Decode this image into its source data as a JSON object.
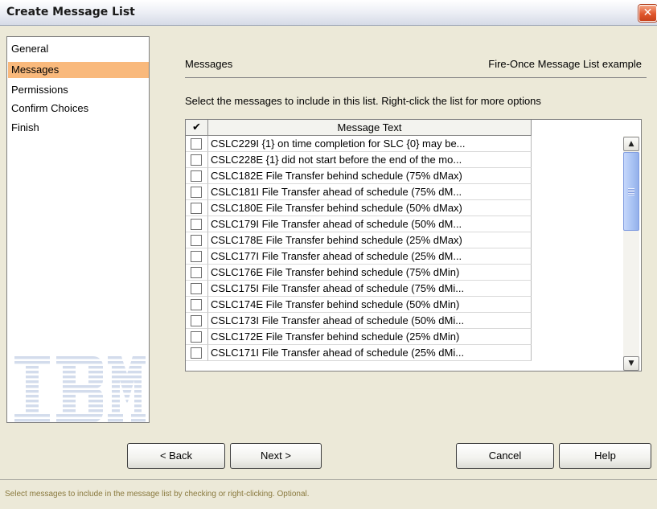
{
  "window": {
    "title": "Create Message List",
    "close_symbol": "✕"
  },
  "nav": {
    "items": [
      {
        "label": "General"
      },
      {
        "label": "Messages",
        "selected": true
      },
      {
        "label": "Permissions"
      },
      {
        "label": "Confirm Choices"
      },
      {
        "label": "Finish"
      }
    ],
    "logo": "IBM"
  },
  "content": {
    "section_title": "Messages",
    "list_name": "Fire-Once Message List example",
    "instructions": "Select the messages to include in this list. Right-click the list for more options"
  },
  "table": {
    "header_check": "✔",
    "header_text": "Message Text",
    "rows": [
      {
        "text": "CSLC229I {1} on time completion for SLC {0} may be...",
        "checked": false
      },
      {
        "text": "CSLC228E {1} did not start before the end of the mo...",
        "checked": false
      },
      {
        "text": "CSLC182E File Transfer behind schedule (75% dMax)",
        "checked": false
      },
      {
        "text": "CSLC181I File Transfer ahead of schedule (75% dM...",
        "checked": false
      },
      {
        "text": "CSLC180E File Transfer behind schedule (50% dMax)",
        "checked": false
      },
      {
        "text": "CSLC179I File Transfer ahead of schedule (50% dM...",
        "checked": false
      },
      {
        "text": "CSLC178E File Transfer behind schedule (25% dMax)",
        "checked": false
      },
      {
        "text": "CSLC177I File Transfer ahead of schedule (25% dM...",
        "checked": false
      },
      {
        "text": "CSLC176E File Transfer behind schedule (75% dMin)",
        "checked": false
      },
      {
        "text": "CSLC175I File Transfer ahead of schedule (75% dMi...",
        "checked": false
      },
      {
        "text": "CSLC174E File Transfer behind schedule (50% dMin)",
        "checked": false
      },
      {
        "text": "CSLC173I File Transfer ahead of schedule (50% dMi...",
        "checked": false
      },
      {
        "text": "CSLC172E File Transfer behind schedule (25% dMin)",
        "checked": false
      },
      {
        "text": "CSLC171I File Transfer ahead of schedule (25% dMi...",
        "checked": false
      }
    ],
    "scroll_up_symbol": "▲",
    "scroll_down_symbol": "▼"
  },
  "buttons": {
    "back": "< Back",
    "next": "Next >",
    "cancel": "Cancel",
    "help": "Help"
  },
  "status": {
    "text": "Select messages to include in the message list by checking or right-clicking. Optional."
  },
  "colors": {
    "selected_nav": "#f9b97c",
    "window_bg": "#ece9d8",
    "close_button": "#e0562c",
    "scroll_thumb": "#a7c1f3",
    "status_text": "#8a7a3f"
  },
  "icons": [
    "close-icon",
    "checkmark-icon",
    "scroll-up-arrow-icon",
    "scroll-down-arrow-icon",
    "ibm-logo"
  ]
}
